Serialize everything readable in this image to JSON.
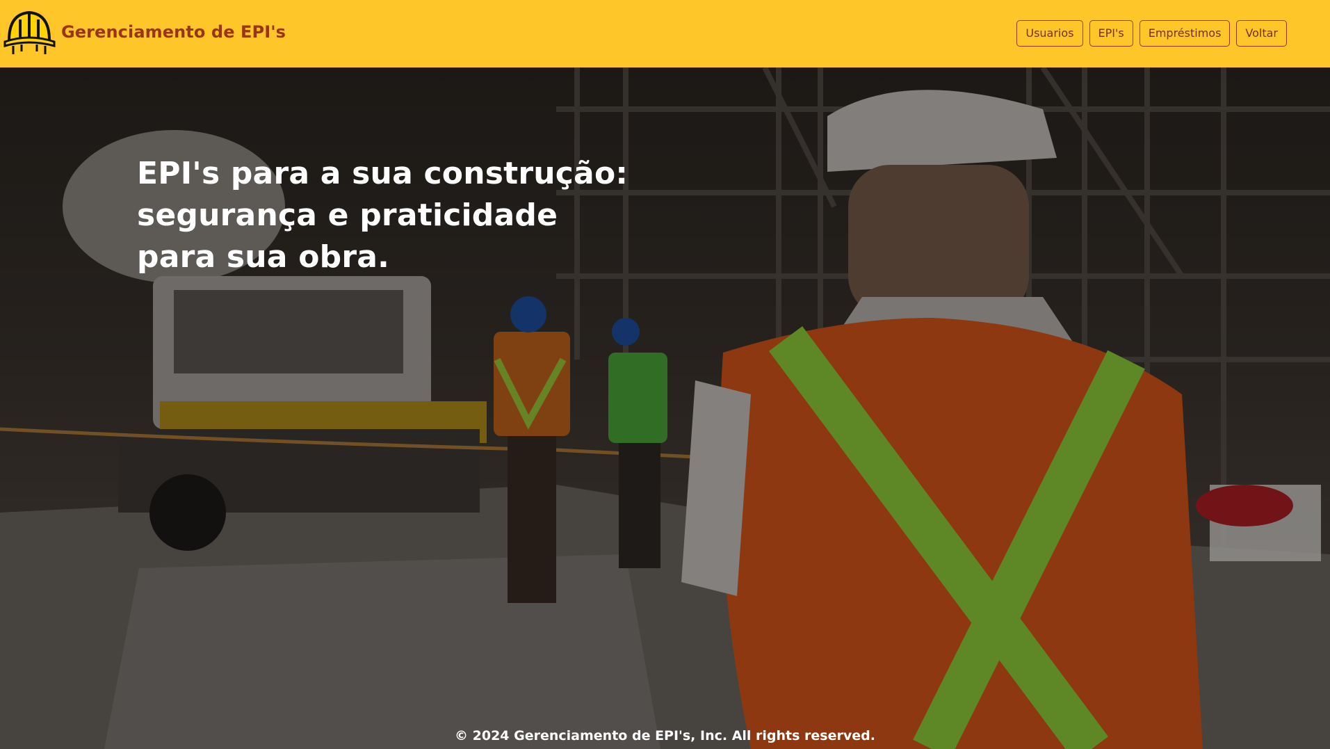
{
  "header": {
    "logo_icon": "hard-hat-icon",
    "brand": "Gerenciamento de EPI's",
    "nav": [
      {
        "label": "Usuarios"
      },
      {
        "label": "EPI's"
      },
      {
        "label": "Empréstimos"
      },
      {
        "label": "Voltar"
      }
    ]
  },
  "hero": {
    "headline": "EPI's para a sua construção: segurança e praticidade para sua obra.",
    "background": "construction-site-worker-photo"
  },
  "footer": {
    "text": "© 2024 Gerenciamento de EPI's, Inc. All rights reserved."
  },
  "colors": {
    "header_bg": "#ffc629",
    "brand_text": "#9a3412",
    "headline_text": "#ffffff"
  }
}
